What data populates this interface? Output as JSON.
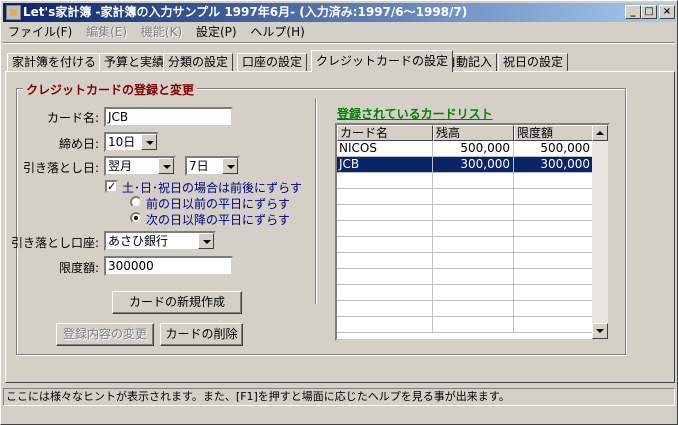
{
  "window": {
    "title": "Let's家計簿 -家計簿の入力サンプル 1997年6月- (入力済み:1997/6〜1998/7)"
  },
  "menu": [
    "ファイル(F)",
    "編集(E)",
    "機能(K)",
    "設定(P)",
    "ヘルプ(H)"
  ],
  "tabs": [
    "家計簿を付ける",
    "予算と実績",
    "分類の設定",
    "口座の設定",
    "クレジットカードの設定",
    "自動記入",
    "祝日の設定"
  ],
  "group": {
    "title": "クレジットカードの登録と変更"
  },
  "form": {
    "card_name_label": "カード名:",
    "card_name_value": "JCB",
    "closing_label": "締め日:",
    "closing_value": "10日",
    "withdraw_label": "引き落とし日:",
    "withdraw_month": "翌月",
    "withdraw_day": "7日",
    "shift_check_label": "土･日･祝日の場合は前後にずらす",
    "shift_check_mark": "✓",
    "option_before": "前の日以前の平日にずらす",
    "option_after": "次の日以降の平日にずらす",
    "account_label": "引き落とし口座:",
    "account_value": "あさひ銀行",
    "limit_label": "限度額:",
    "limit_value": "300000"
  },
  "buttons": {
    "new_card": "カードの新規作成",
    "update": "登録内容の変更",
    "delete": "カードの削除"
  },
  "list": {
    "title": "登録されているカードリスト",
    "columns": [
      "カード名",
      "残高",
      "限度額"
    ],
    "rows": [
      {
        "name": "NICOS",
        "balance": "500,000",
        "limit": "500,000"
      },
      {
        "name": "JCB",
        "balance": "300,000",
        "limit": "300,000"
      }
    ]
  },
  "statusbar": {
    "text": "ここには様々なヒントが表示されます。また、[F1]を押すと場面に応じたヘルプを見る事が出来ます。"
  }
}
